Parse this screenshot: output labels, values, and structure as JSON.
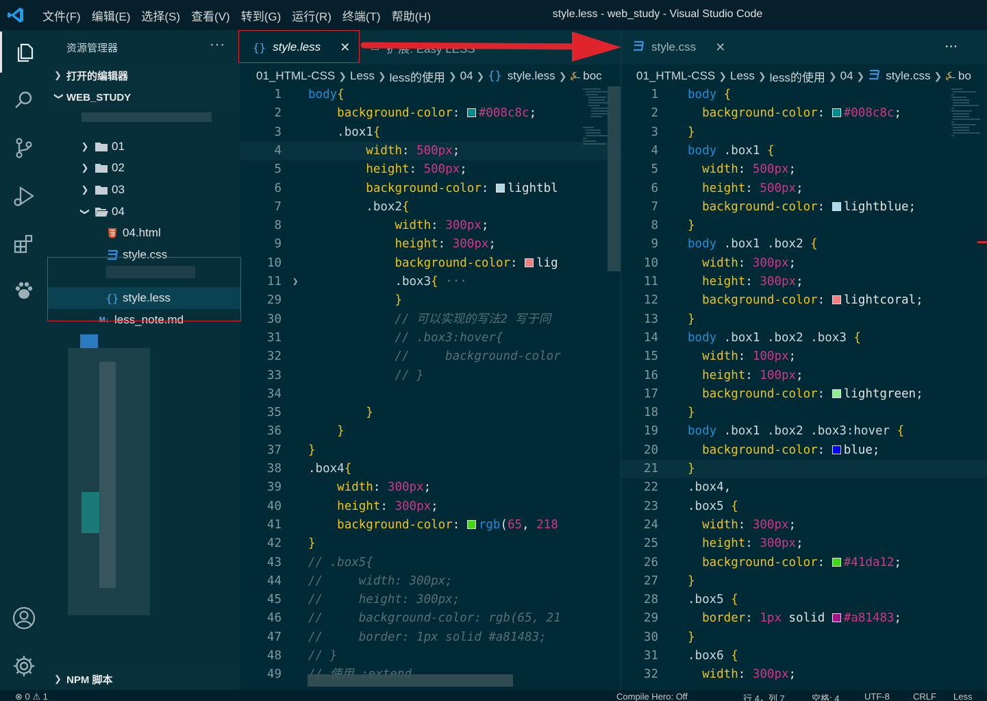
{
  "window": {
    "title": "style.less - web_study - Visual Studio Code"
  },
  "menu": [
    "文件(F)",
    "编辑(E)",
    "选择(S)",
    "查看(V)",
    "转到(G)",
    "运行(R)",
    "终端(T)",
    "帮助(H)"
  ],
  "sidebar": {
    "title": "资源管理器",
    "more": "···",
    "open_editors": "打开的编辑器",
    "workspace": "WEB_STUDY",
    "tree": [
      {
        "label": "01",
        "type": "folder"
      },
      {
        "label": "02",
        "type": "folder"
      },
      {
        "label": "03",
        "type": "folder"
      },
      {
        "label": "04",
        "type": "folder-open"
      },
      {
        "label": "04.html",
        "type": "html"
      },
      {
        "label": "style.css",
        "type": "css"
      },
      {
        "label": "style.less",
        "type": "less"
      },
      {
        "label": "less_note.md",
        "type": "md"
      }
    ],
    "npm": "NPM 脚本"
  },
  "editor_left": {
    "tabs": [
      {
        "label": "style.less",
        "close": "✕"
      },
      {
        "label": "扩展: Easy LESS"
      }
    ],
    "breadcrumb": [
      "01_HTML-CSS",
      "Less",
      "less的使用",
      "04",
      "style.less",
      "boc"
    ],
    "lines": [
      {
        "n": "1",
        "t": "body{"
      },
      {
        "n": "2",
        "t": "    background-color: #008c8c;"
      },
      {
        "n": "3",
        "t": "    .box1{"
      },
      {
        "n": "4",
        "t": "        width: 500px;"
      },
      {
        "n": "5",
        "t": "        height: 500px;"
      },
      {
        "n": "6",
        "t": "        background-color: lightbl"
      },
      {
        "n": "7",
        "t": "        .box2{"
      },
      {
        "n": "8",
        "t": "            width: 300px;"
      },
      {
        "n": "9",
        "t": "            height: 300px;"
      },
      {
        "n": "10",
        "t": "            background-color: lig"
      },
      {
        "n": "11",
        "t": "            .box3{ ···"
      },
      {
        "n": "29",
        "t": "            }"
      },
      {
        "n": "30",
        "t": "            // 可以实现的写法2 写于同"
      },
      {
        "n": "31",
        "t": "            // .box3:hover{"
      },
      {
        "n": "32",
        "t": "            //     background-color"
      },
      {
        "n": "33",
        "t": "            // }"
      },
      {
        "n": "34",
        "t": ""
      },
      {
        "n": "35",
        "t": "        }"
      },
      {
        "n": "36",
        "t": "    }"
      },
      {
        "n": "37",
        "t": "}"
      },
      {
        "n": "38",
        "t": ".box4{"
      },
      {
        "n": "39",
        "t": "    width: 300px;"
      },
      {
        "n": "40",
        "t": "    height: 300px;"
      },
      {
        "n": "41",
        "t": "    background-color: rgb(65, 218"
      },
      {
        "n": "42",
        "t": "}"
      },
      {
        "n": "43",
        "t": "// .box5{"
      },
      {
        "n": "44",
        "t": "//     width: 300px;"
      },
      {
        "n": "45",
        "t": "//     height: 300px;"
      },
      {
        "n": "46",
        "t": "//     background-color: rgb(65, 21"
      },
      {
        "n": "47",
        "t": "//     border: 1px solid #a81483;"
      },
      {
        "n": "48",
        "t": "// }"
      },
      {
        "n": "49",
        "t": "// 使用 :extend"
      }
    ]
  },
  "editor_right": {
    "tab": {
      "label": "style.css",
      "close": "✕"
    },
    "more": "···",
    "breadcrumb": [
      "01_HTML-CSS",
      "Less",
      "less的使用",
      "04",
      "style.css",
      "bo"
    ],
    "lines": [
      {
        "n": "1",
        "t": "body {"
      },
      {
        "n": "2",
        "t": "  background-color: #008c8c;"
      },
      {
        "n": "3",
        "t": "}"
      },
      {
        "n": "4",
        "t": "body .box1 {"
      },
      {
        "n": "5",
        "t": "  width: 500px;"
      },
      {
        "n": "6",
        "t": "  height: 500px;"
      },
      {
        "n": "7",
        "t": "  background-color: lightblue;"
      },
      {
        "n": "8",
        "t": "}"
      },
      {
        "n": "9",
        "t": "body .box1 .box2 {"
      },
      {
        "n": "10",
        "t": "  width: 300px;"
      },
      {
        "n": "11",
        "t": "  height: 300px;"
      },
      {
        "n": "12",
        "t": "  background-color: lightcoral;"
      },
      {
        "n": "13",
        "t": "}"
      },
      {
        "n": "14",
        "t": "body .box1 .box2 .box3 {"
      },
      {
        "n": "15",
        "t": "  width: 100px;"
      },
      {
        "n": "16",
        "t": "  height: 100px;"
      },
      {
        "n": "17",
        "t": "  background-color: lightgreen;"
      },
      {
        "n": "18",
        "t": "}"
      },
      {
        "n": "19",
        "t": "body .box1 .box2 .box3:hover {"
      },
      {
        "n": "20",
        "t": "  background-color: blue;"
      },
      {
        "n": "21",
        "t": "}"
      },
      {
        "n": "22",
        "t": ".box4,"
      },
      {
        "n": "23",
        "t": ".box5 {"
      },
      {
        "n": "24",
        "t": "  width: 300px;"
      },
      {
        "n": "25",
        "t": "  height: 300px;"
      },
      {
        "n": "26",
        "t": "  background-color: #41da12;"
      },
      {
        "n": "27",
        "t": "}"
      },
      {
        "n": "28",
        "t": ".box5 {"
      },
      {
        "n": "29",
        "t": "  border: 1px solid #a81483;"
      },
      {
        "n": "30",
        "t": "}"
      },
      {
        "n": "31",
        "t": ".box6 {"
      },
      {
        "n": "32",
        "t": "  width: 300px;"
      }
    ]
  },
  "statusbar": {
    "problems": "⊗ 0 ⚠ 1",
    "compile": "Compile Hero: Off",
    "position": "行 4，列 7",
    "spaces": "空格: 4",
    "encoding": "UTF-8",
    "eol": "CRLF",
    "language": "Less"
  },
  "colors": {
    "accent_red": "#e0242c",
    "bg": "#002b36",
    "sidebar": "#062f3a",
    "keyword": "#268bd2",
    "number": "#d33682",
    "property": "#f0c419"
  }
}
